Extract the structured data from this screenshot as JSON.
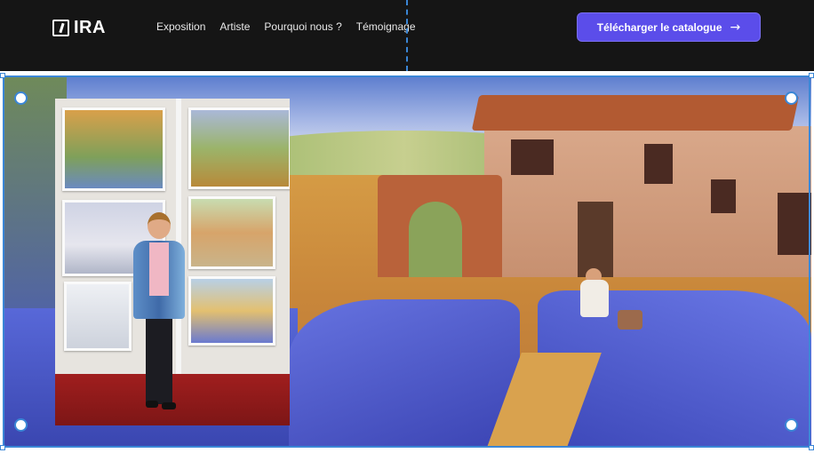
{
  "brand": {
    "name": "IRA",
    "logo_icon": "ira-logo-icon"
  },
  "nav": {
    "items": [
      {
        "label": "Exposition"
      },
      {
        "label": "Artiste"
      },
      {
        "label": "Pourquoi nous ?"
      },
      {
        "label": "Témoignage"
      }
    ]
  },
  "cta": {
    "label": "Télécharger le catalogue",
    "icon": "arrow-right-icon"
  },
  "colors": {
    "nav_background": "#151515",
    "cta_background": "#5b4dea",
    "selection_accent": "#3a86d6"
  },
  "hero": {
    "background_image": "Impressionist painting of lavender fields and a farmhouse",
    "inset_photo": "Artist standing in front of her paintings at an exhibition"
  }
}
